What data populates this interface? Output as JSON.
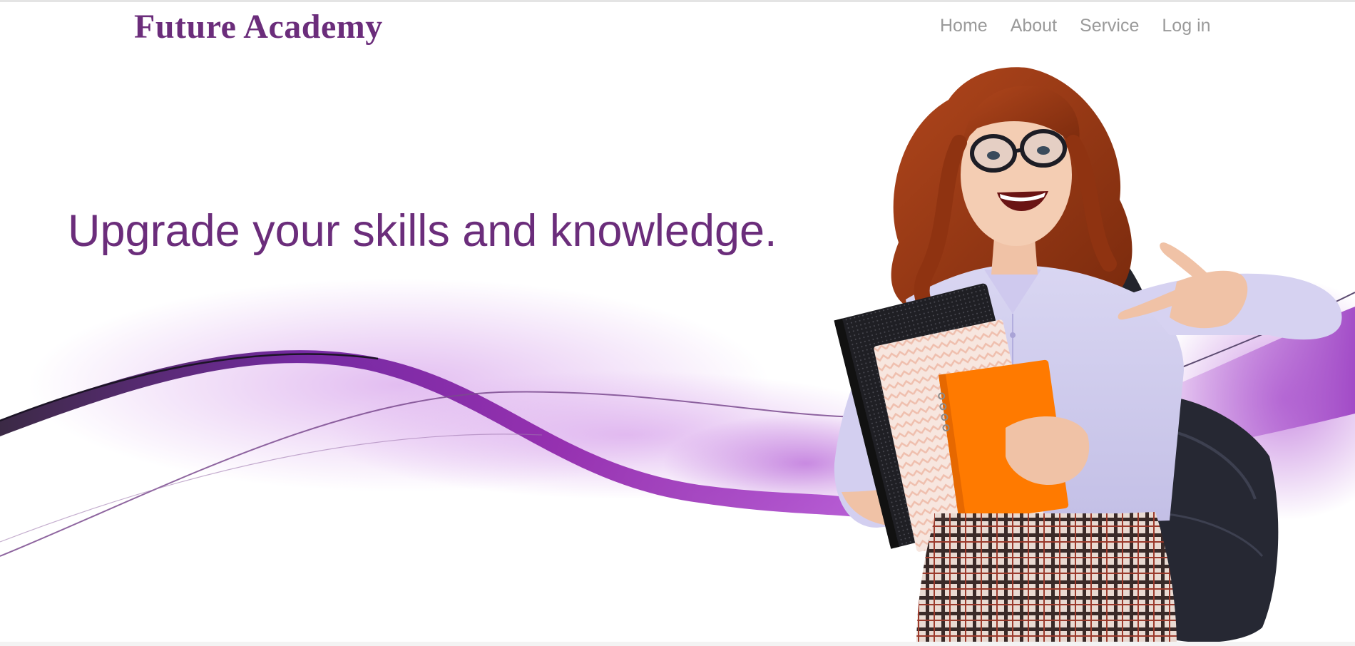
{
  "brand": {
    "logo_text": "Future Academy",
    "color": "#6b2d7b"
  },
  "nav": {
    "items": [
      "Home",
      "About",
      "Service",
      "Log in"
    ],
    "color": "#9a9a9a"
  },
  "hero": {
    "headline": "Upgrade your skills and knowledge.",
    "accent": "#7b1fa2",
    "image_icon": "student-holding-notebooks-illustration"
  }
}
